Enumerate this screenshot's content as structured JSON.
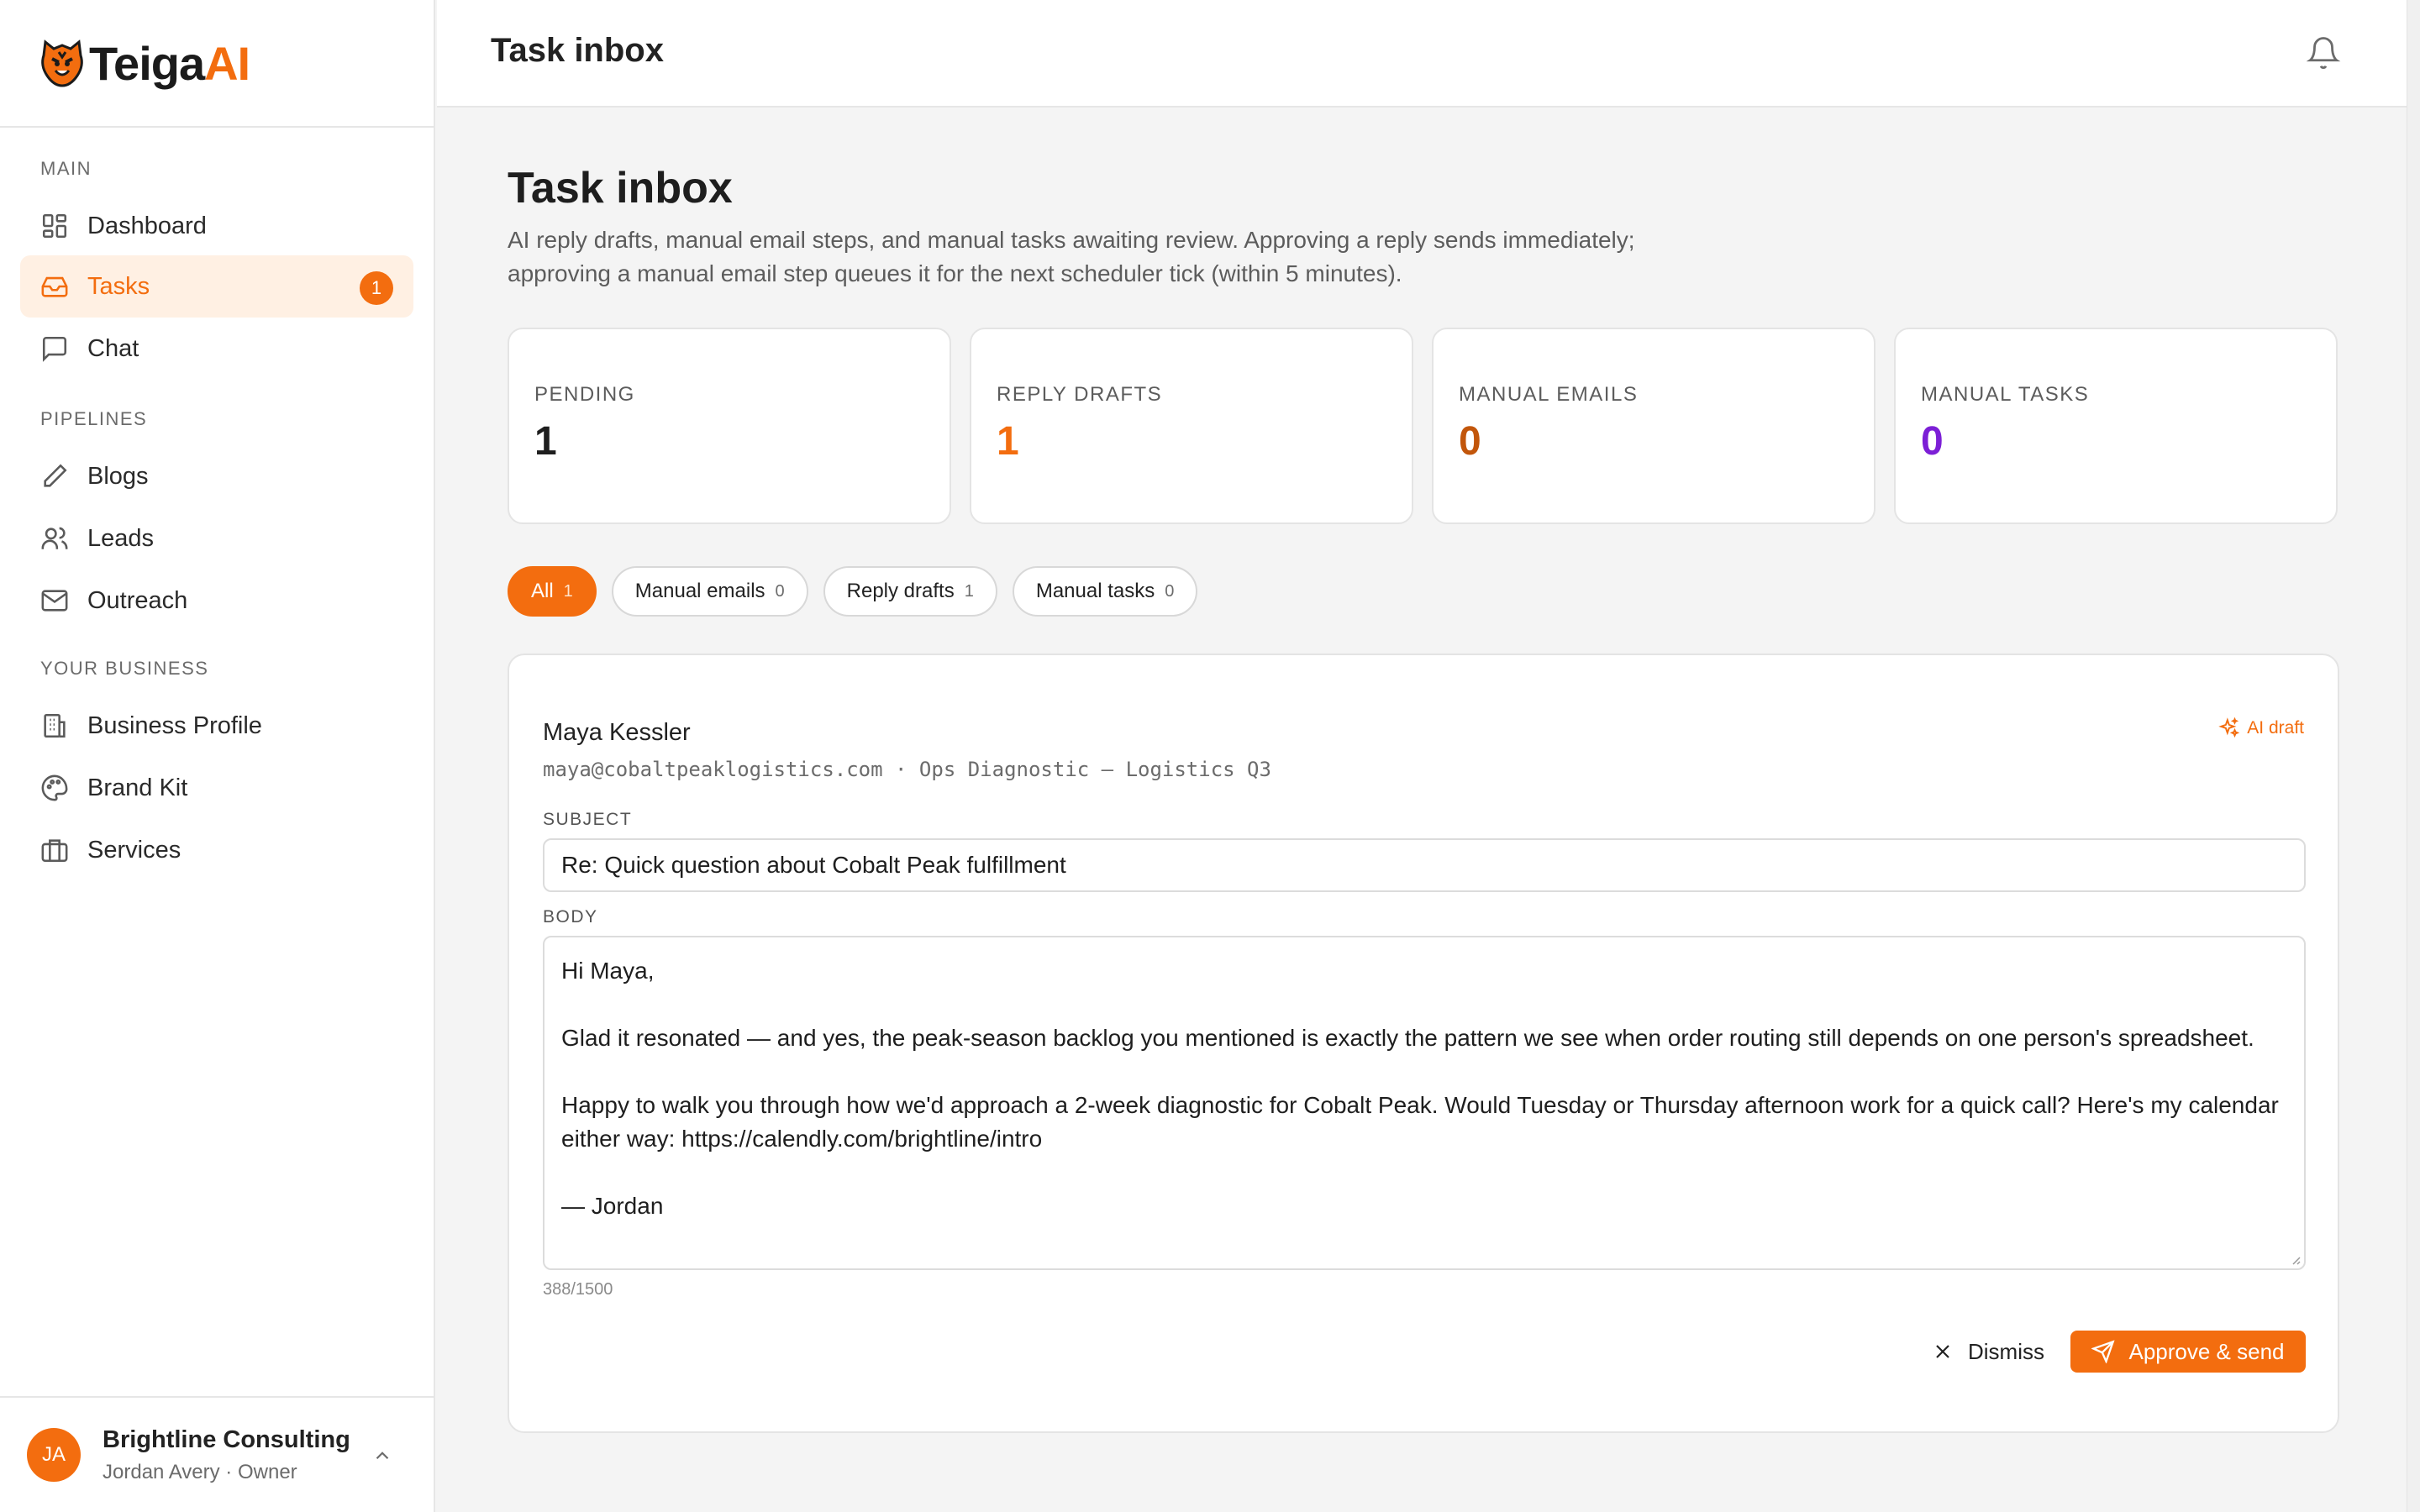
{
  "app": {
    "brand_name_main": "Teiga",
    "brand_name_accent": "AI",
    "accent_color": "#f36d0f"
  },
  "sidebar": {
    "sections": [
      {
        "label": "MAIN"
      },
      {
        "label": "PIPELINES"
      },
      {
        "label": "YOUR BUSINESS"
      }
    ],
    "items": [
      {
        "label": "Dashboard",
        "icon": "dashboard-icon"
      },
      {
        "label": "Tasks",
        "icon": "inbox-icon",
        "badge": "1",
        "active": true
      },
      {
        "label": "Chat",
        "icon": "chat-icon"
      },
      {
        "label": "Blogs",
        "icon": "pen-icon"
      },
      {
        "label": "Leads",
        "icon": "users-icon"
      },
      {
        "label": "Outreach",
        "icon": "mail-icon"
      },
      {
        "label": "Business Profile",
        "icon": "building-icon"
      },
      {
        "label": "Brand Kit",
        "icon": "palette-icon"
      },
      {
        "label": "Services",
        "icon": "briefcase-icon"
      }
    ],
    "account": {
      "initials": "JA",
      "name": "Brightline Consulting",
      "subtitle": "Jordan Avery · Owner"
    }
  },
  "header": {
    "title": "Task inbox",
    "bell_icon": "bell-icon"
  },
  "page": {
    "title": "Task inbox",
    "description": "AI reply drafts, manual email steps, and manual tasks awaiting review. Approving a reply sends immediately; approving a manual email step queues it for the next scheduler tick (within 5 minutes)."
  },
  "stats": [
    {
      "label": "PENDING",
      "value": "1",
      "color": "#1e1e1e"
    },
    {
      "label": "REPLY DRAFTS",
      "value": "1",
      "color": "#f36d0f"
    },
    {
      "label": "MANUAL EMAILS",
      "value": "0",
      "color": "#c2560b"
    },
    {
      "label": "MANUAL TASKS",
      "value": "0",
      "color": "#7c1fd6"
    }
  ],
  "filters": [
    {
      "label": "All",
      "count": "1",
      "active": true
    },
    {
      "label": "Manual emails",
      "count": "0"
    },
    {
      "label": "Reply drafts",
      "count": "1"
    },
    {
      "label": "Manual tasks",
      "count": "0"
    }
  ],
  "task": {
    "sender_name": "Maya Kessler",
    "sender_meta": "maya@cobaltpeaklogistics.com · Ops Diagnostic — Logistics Q3",
    "tag": "AI draft",
    "subject_label": "SUBJECT",
    "subject": "Re: Quick question about Cobalt Peak fulfillment",
    "body_label": "BODY",
    "body_lines": [
      "Hi Maya,",
      "",
      "Glad it resonated — and yes, the peak-season backlog you mentioned is exactly the pattern we see when order routing still depends on one person's spreadsheet.",
      "",
      "Happy to walk you through how we'd approach a 2-week diagnostic for Cobalt Peak. Would Tuesday or Thursday afternoon work for a quick call? Here's my calendar either way: https://calendly.com/brightline/intro",
      "",
      "— Jordan"
    ],
    "char_count": "388/1500",
    "dismiss_label": "Dismiss",
    "approve_label": "Approve & send"
  }
}
